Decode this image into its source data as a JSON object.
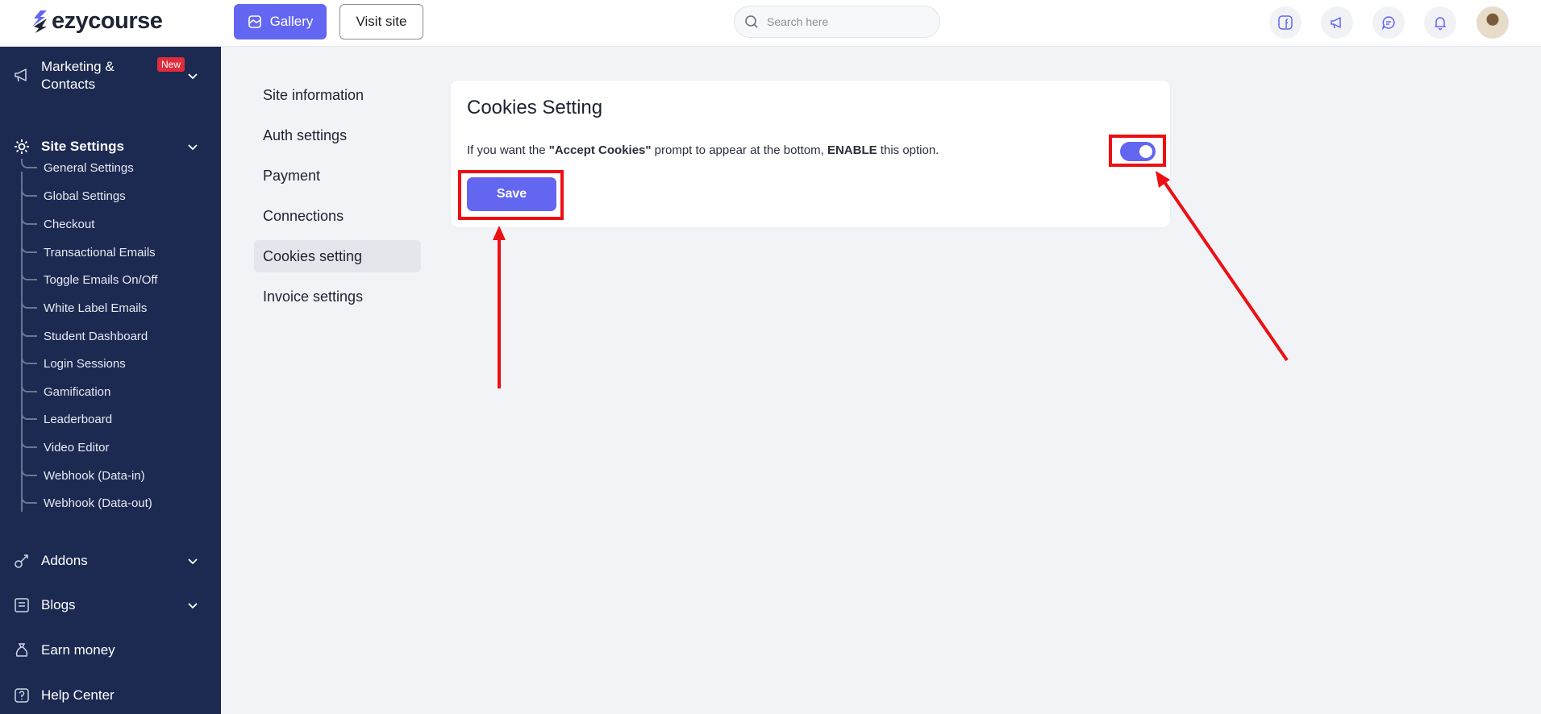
{
  "brand": {
    "name": "ezycourse",
    "accent": "#6366f1",
    "sidebar_bg": "#1c2a52"
  },
  "header": {
    "gallery_label": "Gallery",
    "visit_label": "Visit site",
    "search_placeholder": "Search here",
    "icons": [
      "facebook-icon",
      "megaphone-icon",
      "chat-icon",
      "bell-icon"
    ]
  },
  "sidebar": {
    "marketing": {
      "label": "Marketing & Contacts",
      "badge": "New"
    },
    "site_settings": {
      "label": "Site Settings"
    },
    "sub_items": [
      "General Settings",
      "Global Settings",
      "Checkout",
      "Transactional Emails",
      "Toggle Emails On/Off",
      "White Label Emails",
      "Student Dashboard",
      "Login Sessions",
      "Gamification",
      "Leaderboard",
      "Video Editor",
      "Webhook (Data-in)",
      "Webhook (Data-out)"
    ],
    "addons": {
      "label": "Addons"
    },
    "blogs": {
      "label": "Blogs"
    },
    "earn": {
      "label": "Earn money"
    },
    "help": {
      "label": "Help Center"
    }
  },
  "settings_nav": {
    "items": [
      "Site information",
      "Auth settings",
      "Payment",
      "Connections",
      "Cookies setting",
      "Invoice settings"
    ],
    "active_index": 4
  },
  "card": {
    "title": "Cookies Setting",
    "desc_prefix": "If you want the ",
    "desc_bold1": "\"Accept Cookies\"",
    "desc_mid": " prompt to appear at the bottom, ",
    "desc_bold2": "ENABLE",
    "desc_suffix": " this option.",
    "toggle_on": true,
    "save_label": "Save"
  },
  "annotation_color": "#ec0f13"
}
